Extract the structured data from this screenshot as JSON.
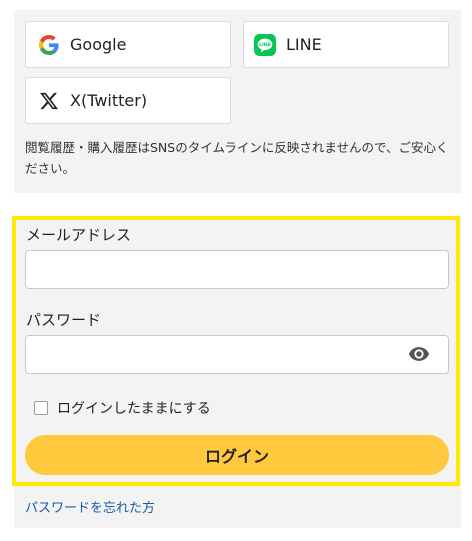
{
  "social": {
    "google_label": "Google",
    "line_label": "LINE",
    "line_icon_text": "LINE",
    "x_label": "X(Twitter)",
    "notice": "閲覧履歴・購入履歴はSNSのタイムラインに反映されませんので、ご安心ください。"
  },
  "form": {
    "email_label": "メールアドレス",
    "email_value": "",
    "password_label": "パスワード",
    "password_value": "",
    "remember_label": "ログインしたままにする",
    "login_button": "ログイン",
    "forgot_link": "パスワードを忘れた方"
  },
  "colors": {
    "google_blue": "#4285F4",
    "google_red": "#EA4335",
    "google_yellow": "#FBBC05",
    "google_green": "#34A853",
    "line_green": "#06C755",
    "login_button_bg": "#ffc83d",
    "highlight_border": "#ffeb00",
    "link": "#1a5aa8"
  },
  "icons": [
    "google-icon",
    "line-icon",
    "x-icon",
    "eye-icon"
  ]
}
